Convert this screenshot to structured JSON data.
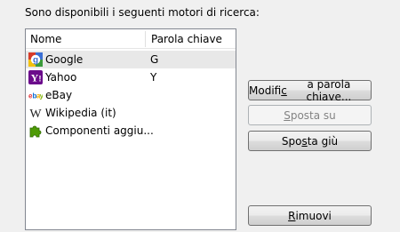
{
  "heading": "Sono disponibili i seguenti motori di ricerca:",
  "table": {
    "columns": [
      "Nome",
      "Parola chiave"
    ],
    "rows": [
      {
        "name": "Google",
        "keyword": "G",
        "icon": "google-icon"
      },
      {
        "name": "Yahoo",
        "keyword": "Y",
        "icon": "yahoo-icon"
      },
      {
        "name": "eBay",
        "keyword": "",
        "icon": "ebay-icon"
      },
      {
        "name": "Wikipedia (it)",
        "keyword": "",
        "icon": "wikipedia-icon"
      },
      {
        "name": "Componenti aggiu...",
        "keyword": "",
        "icon": "puzzle-icon"
      }
    ]
  },
  "buttons": {
    "edit_keyword": {
      "before": "Modifi",
      "accel": "c",
      "after": "a parola chiave..."
    },
    "move_up": {
      "before": "",
      "accel": "S",
      "after": "posta su"
    },
    "move_down": {
      "before": "Spo",
      "accel": "s",
      "after": "ta giù"
    },
    "remove": {
      "before": "",
      "accel": "R",
      "after": "imuovi"
    }
  },
  "colors": {
    "background": "#f0f0f0",
    "selected_row": "#e8e8e8",
    "google_blue": "#3b6fd4",
    "google_red": "#d63b2a",
    "google_yellow": "#f3c10f",
    "google_green": "#3a9a3a",
    "yahoo_purple": "#6b0b8b",
    "puzzle_green": "#4e9a06"
  }
}
